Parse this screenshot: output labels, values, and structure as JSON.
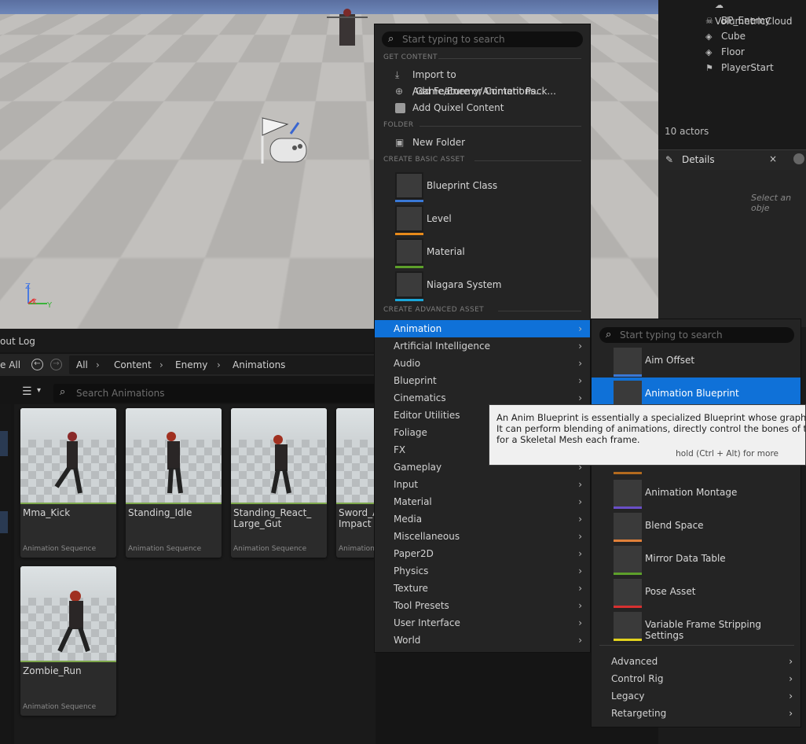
{
  "outliner": {
    "items": [
      {
        "label": "VolumetricCloud",
        "icon": "cloud-icon"
      },
      {
        "label": "BP_Enemy",
        "icon": "skeleton-icon"
      },
      {
        "label": "Cube",
        "icon": "cube-icon"
      },
      {
        "label": "Floor",
        "icon": "cube-icon"
      },
      {
        "label": "PlayerStart",
        "icon": "player-start-icon"
      }
    ],
    "actor_count": "10 actors"
  },
  "details": {
    "tab_label": "Details",
    "close": "×",
    "placeholder": "Select an obje"
  },
  "content_browser": {
    "tab_label": "out Log",
    "save_all": "e All",
    "breadcrumb": [
      "All",
      "Content",
      "Enemy",
      "Animations"
    ],
    "search_placeholder": "Search Animations",
    "assets": [
      {
        "name": "Mma_Kick",
        "type": "Animation Sequence"
      },
      {
        "name": "Standing_Idle",
        "type": "Animation Sequence"
      },
      {
        "name": "Standing_React_Large_Gut",
        "name_line1": "Standing_React_",
        "name_line2": "Large_Gut",
        "type": "Animation Sequence"
      },
      {
        "name": "Sword_Impact",
        "name_line1": "Sword_A",
        "name_line2": "Impact",
        "type": "Animation"
      },
      {
        "name": "Zombie_Run",
        "type": "Animation Sequence"
      }
    ]
  },
  "menu": {
    "search_placeholder": "Start typing to search",
    "sections": {
      "get_content": "GET CONTENT",
      "folder": "FOLDER",
      "create_basic": "CREATE BASIC ASSET",
      "create_advanced": "CREATE ADVANCED ASSET"
    },
    "get_content_items": [
      "Import to /Game/Enemy/Animations...",
      "Add Feature or Content Pack...",
      "Add Quixel Content"
    ],
    "folder_items": [
      "New Folder"
    ],
    "basic_assets": [
      {
        "label": "Blueprint Class",
        "color": "#3a78d6"
      },
      {
        "label": "Level",
        "color": "#e88a1a"
      },
      {
        "label": "Material",
        "color": "#5da02b"
      },
      {
        "label": "Niagara System",
        "color": "#1aa6d8"
      }
    ],
    "advanced_categories": [
      "Animation",
      "Artificial Intelligence",
      "Audio",
      "Blueprint",
      "Cinematics",
      "Editor Utilities",
      "Foliage",
      "FX",
      "Gameplay",
      "Input",
      "Material",
      "Media",
      "Miscellaneous",
      "Paper2D",
      "Physics",
      "Texture",
      "Tool Presets",
      "User Interface",
      "World"
    ]
  },
  "submenu": {
    "search_placeholder": "Start typing to search",
    "items": [
      {
        "label": "Aim Offset",
        "color": "#3a78d6"
      },
      {
        "label": "Animation Blueprint",
        "color": "#3a78d6"
      },
      {
        "label": "",
        "color": "#b36a1e"
      },
      {
        "label": "Animation Montage",
        "color": "#6a4fc8"
      },
      {
        "label": "Blend Space",
        "color": "#e0803a"
      },
      {
        "label": "Mirror Data Table",
        "color": "#5da02b"
      },
      {
        "label": "Pose Asset",
        "color": "#d63030"
      },
      {
        "label": "Variable Frame Stripping Settings",
        "color": "#e2d21e"
      }
    ],
    "categories": [
      "Advanced",
      "Control Rig",
      "Legacy",
      "Retargeting"
    ]
  },
  "tooltip": {
    "line1": "An Anim Blueprint is essentially a specialized Blueprint whose graphs con",
    "line2": "It can perform blending of animations, directly control the bones of the ske",
    "line3": "for a Skeletal Mesh each frame.",
    "hint": "hold (Ctrl + Alt) for more"
  }
}
